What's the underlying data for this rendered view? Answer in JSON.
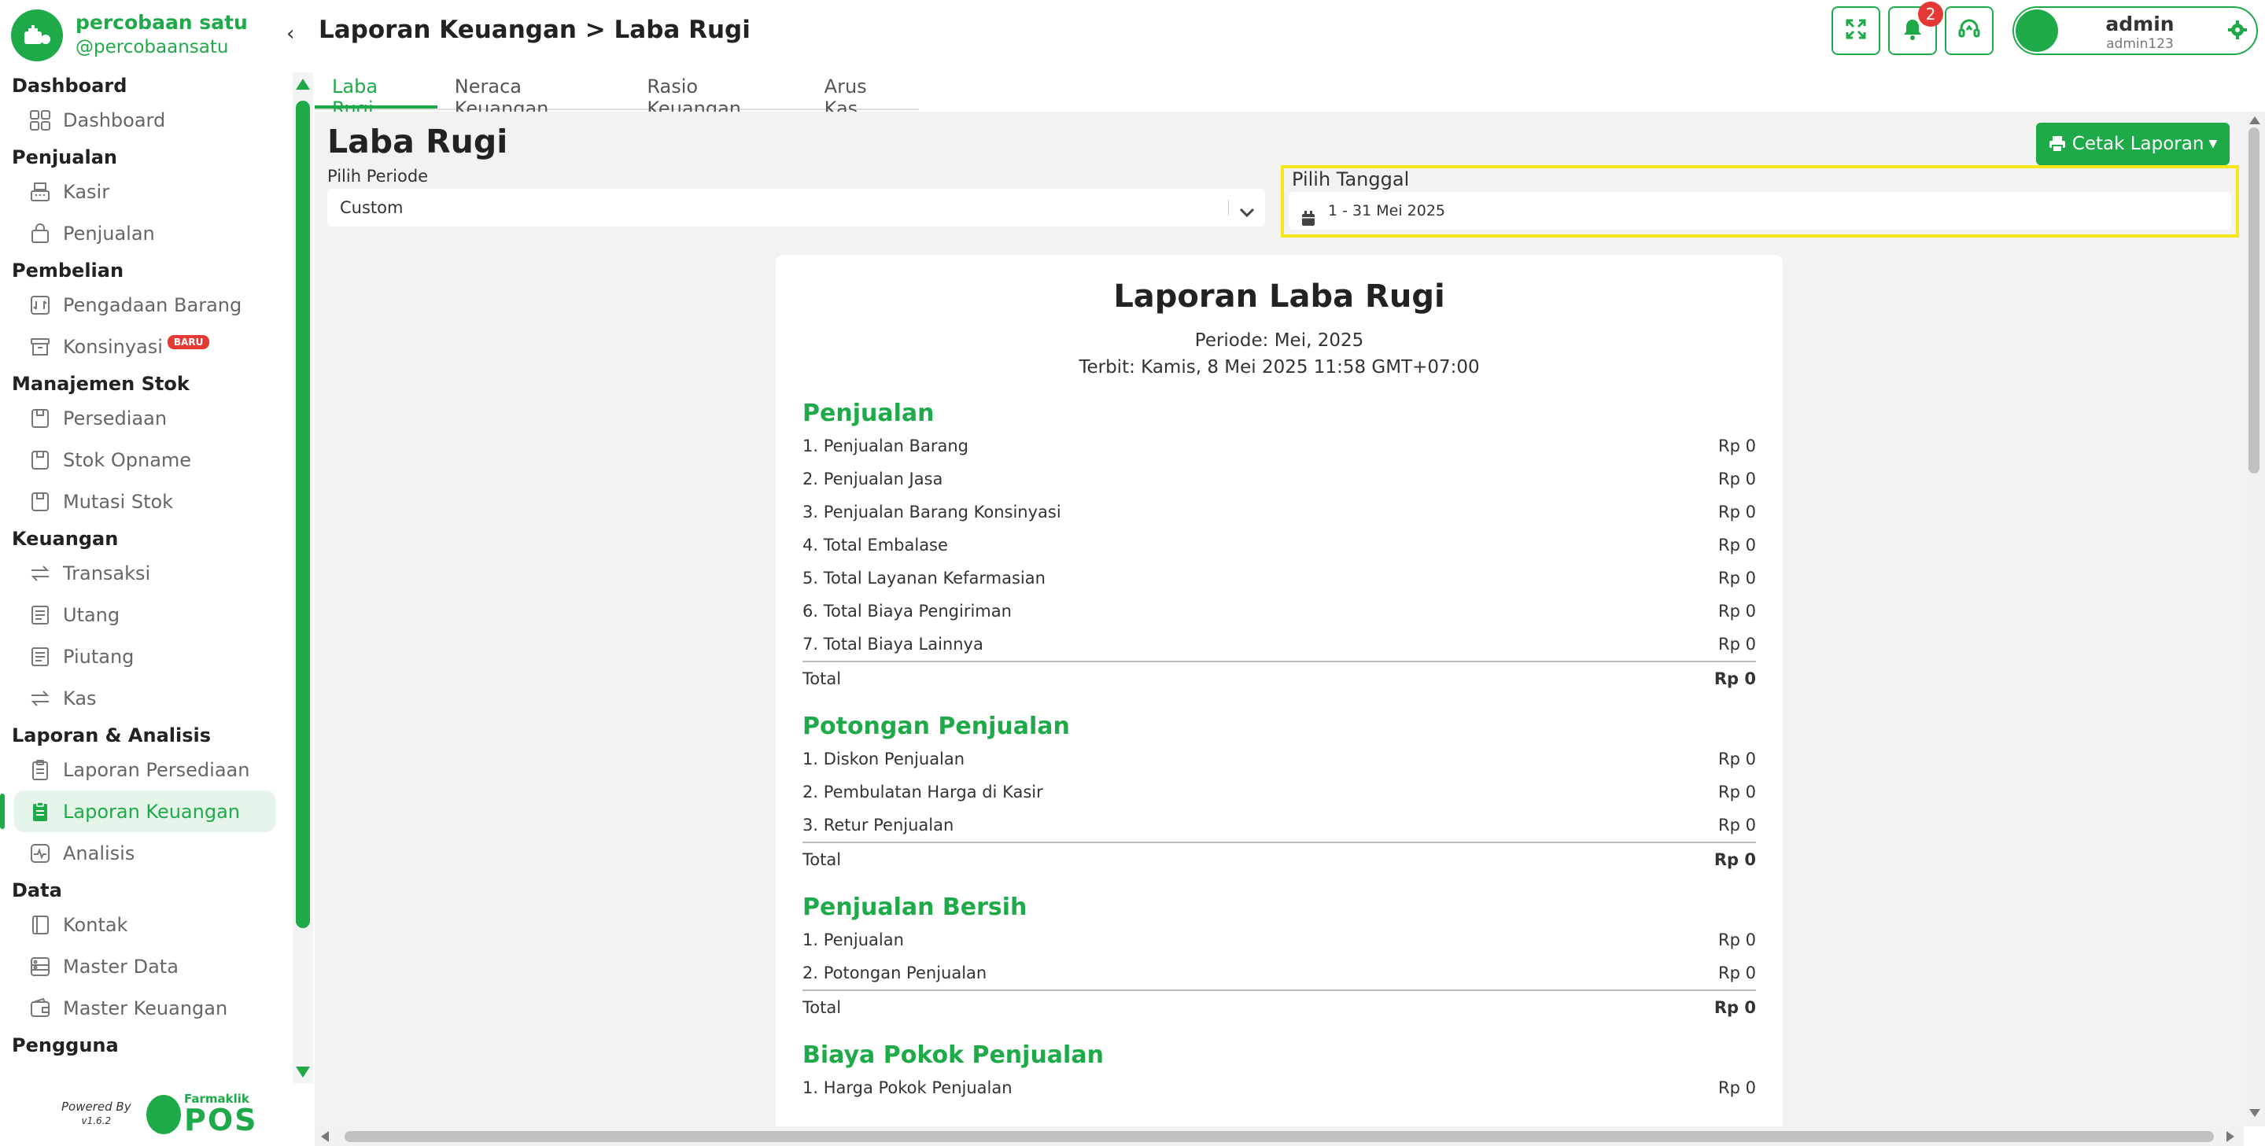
{
  "brand": {
    "name": "percobaan satu",
    "handle": "@percobaansatu"
  },
  "sidebar": {
    "sections": [
      {
        "title": "Dashboard",
        "items": [
          {
            "label": "Dashboard",
            "icon": "grid-icon"
          }
        ]
      },
      {
        "title": "Penjualan",
        "items": [
          {
            "label": "Kasir",
            "icon": "cash-register-icon"
          },
          {
            "label": "Penjualan",
            "icon": "shopping-bag-icon"
          }
        ]
      },
      {
        "title": "Pembelian",
        "items": [
          {
            "label": "Pengadaan Barang",
            "icon": "procurement-icon"
          },
          {
            "label": "Konsinyasi",
            "icon": "archive-box-icon",
            "badge": "BARU"
          }
        ]
      },
      {
        "title": "Manajemen Stok",
        "items": [
          {
            "label": "Persediaan",
            "icon": "box-icon"
          },
          {
            "label": "Stok Opname",
            "icon": "box-icon"
          },
          {
            "label": "Mutasi Stok",
            "icon": "box-icon"
          }
        ]
      },
      {
        "title": "Keuangan",
        "items": [
          {
            "label": "Transaksi",
            "icon": "transfer-icon"
          },
          {
            "label": "Utang",
            "icon": "document-icon"
          },
          {
            "label": "Piutang",
            "icon": "document-icon"
          },
          {
            "label": "Kas",
            "icon": "transfer-icon"
          }
        ]
      },
      {
        "title": "Laporan & Analisis",
        "items": [
          {
            "label": "Laporan Persediaan",
            "icon": "clipboard-icon"
          },
          {
            "label": "Laporan Keuangan",
            "icon": "clipboard-icon",
            "active": true
          },
          {
            "label": "Analisis",
            "icon": "pulse-icon"
          }
        ]
      },
      {
        "title": "Data",
        "items": [
          {
            "label": "Kontak",
            "icon": "contact-book-icon"
          },
          {
            "label": "Master Data",
            "icon": "database-icon"
          },
          {
            "label": "Master Keuangan",
            "icon": "wallet-icon"
          }
        ]
      },
      {
        "title": "Pengguna",
        "items": []
      }
    ],
    "powered_by": "Powered By",
    "version": "v1.6.2",
    "vendor_small": "Farmaklik",
    "vendor_big": "POS"
  },
  "header": {
    "breadcrumb": "Laporan Keuangan > Laba Rugi",
    "notification_count": "2",
    "user_name": "admin",
    "user_id": "admin123"
  },
  "tabs": [
    "Laba Rugi",
    "Neraca Keuangan",
    "Rasio Keuangan",
    "Arus Kas"
  ],
  "page": {
    "title": "Laba Rugi",
    "print_button": "Cetak Laporan",
    "periode_label": "Pilih Periode",
    "periode_value": "Custom",
    "tanggal_label": "Pilih Tanggal",
    "tanggal_value": "1 - 31 Mei 2025"
  },
  "report": {
    "title": "Laporan Laba Rugi",
    "periode": "Periode: Mei, 2025",
    "terbit": "Terbit: Kamis, 8 Mei 2025 11:58 GMT+07:00",
    "sections": [
      {
        "title": "Penjualan",
        "rows": [
          [
            "1. Penjualan Barang",
            "Rp 0"
          ],
          [
            "2. Penjualan Jasa",
            "Rp 0"
          ],
          [
            "3. Penjualan Barang Konsinyasi",
            "Rp 0"
          ],
          [
            "4. Total Embalase",
            "Rp 0"
          ],
          [
            "5. Total Layanan Kefarmasian",
            "Rp 0"
          ],
          [
            "6. Total Biaya Pengiriman",
            "Rp 0"
          ],
          [
            "7. Total Biaya Lainnya",
            "Rp 0"
          ]
        ],
        "total": [
          "Total",
          "Rp 0"
        ]
      },
      {
        "title": "Potongan Penjualan",
        "rows": [
          [
            "1. Diskon Penjualan",
            "Rp 0"
          ],
          [
            "2. Pembulatan Harga di Kasir",
            "Rp 0"
          ],
          [
            "3. Retur Penjualan",
            "Rp 0"
          ]
        ],
        "total": [
          "Total",
          "Rp 0"
        ]
      },
      {
        "title": "Penjualan Bersih",
        "rows": [
          [
            "1. Penjualan",
            "Rp 0"
          ],
          [
            "2. Potongan Penjualan",
            "Rp 0"
          ]
        ],
        "total": [
          "Total",
          "Rp 0"
        ]
      },
      {
        "title": "Biaya Pokok Penjualan",
        "rows": [
          [
            "1. Harga Pokok Penjualan",
            "Rp 0"
          ]
        ],
        "total": null
      }
    ]
  },
  "colors": {
    "accent": "#1faa4a",
    "highlight": "#f5e61a",
    "badge": "#e53935",
    "background": "#f2f2f2"
  }
}
